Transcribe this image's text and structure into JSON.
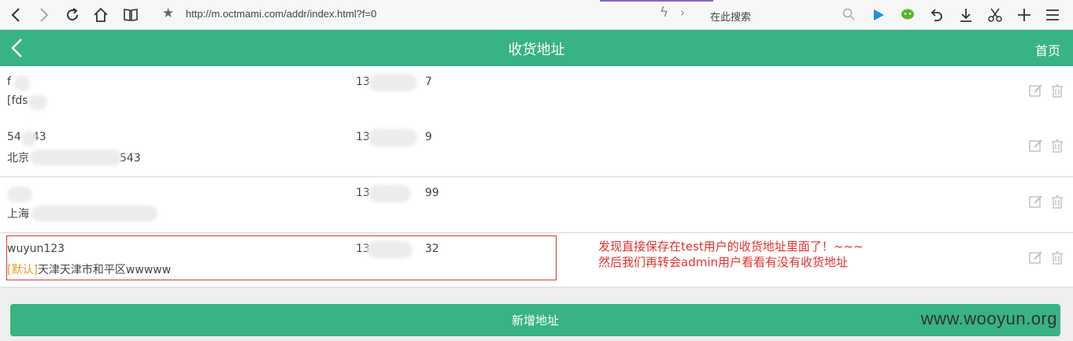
{
  "browser": {
    "url": "http://m.octmami.com/addr/index.html?f=0",
    "search_placeholder": "在此搜索",
    "icons": [
      "back-icon",
      "forward-icon",
      "reload-icon",
      "home-icon",
      "reader-icon",
      "star-icon",
      "bolt-icon",
      "chevron-right-icon",
      "search-icon",
      "play-icon",
      "wechat-icon",
      "undo-icon",
      "download-icon",
      "scissors-icon",
      "plus-icon",
      "menu-icon"
    ]
  },
  "header": {
    "title": "收货地址",
    "home_label": "首页",
    "color": "#38b383"
  },
  "addresses": [
    {
      "name": "f",
      "phone": "13",
      "phone_tail": "7",
      "address": "[fds"
    },
    {
      "name": "54",
      "name_tail": "43",
      "phone": "13",
      "phone_tail": "9",
      "address": "北京",
      "address_tail": "543"
    },
    {
      "name": "",
      "phone": "13",
      "phone_tail": "99",
      "address": "上海"
    },
    {
      "name": "wuyun123",
      "phone": "13",
      "phone_tail": "32",
      "default_tag": "[默认]",
      "address": "天津天津市和平区wwwww"
    }
  ],
  "annotation": {
    "line1": "发现直接保存在test用户的收货地址里面了！~~~",
    "line2": "然后我们再转会admin用户看看有没有收货地址"
  },
  "footer": {
    "add_button_label": "新增地址"
  },
  "watermark": "www.wooyun.org"
}
